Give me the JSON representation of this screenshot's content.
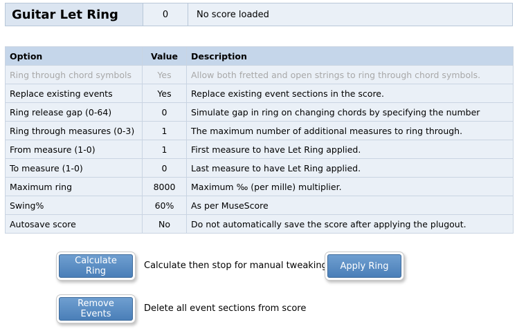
{
  "header": {
    "title": "Guitar Let Ring",
    "value": "0",
    "status": "No score loaded"
  },
  "table": {
    "columns": [
      "Option",
      "Value",
      "Description"
    ],
    "rows": [
      {
        "option": "Ring through chord symbols",
        "value": "Yes",
        "description": "Allow both fretted and open strings to ring through chord symbols."
      },
      {
        "option": "Replace existing events",
        "value": "Yes",
        "description": "Replace existing event sections in the score."
      },
      {
        "option": "Ring release gap (0-64)",
        "value": "0",
        "description": "Simulate gap in ring on changing chords by specifying the number"
      },
      {
        "option": "Ring through measures (0-3)",
        "value": "1",
        "description": "The maximum number of additional measures to ring through."
      },
      {
        "option": "From measure (1-0)",
        "value": "1",
        "description": "First measure to have Let Ring applied."
      },
      {
        "option": "To measure (1-0)",
        "value": "0",
        "description": "Last measure to have Let Ring applied."
      },
      {
        "option": "Maximum ring",
        "value": "8000",
        "description": "Maximum ‰ (per mille) multiplier."
      },
      {
        "option": "Swing%",
        "value": "60%",
        "description": "As per MuseScore"
      },
      {
        "option": "Autosave score",
        "value": "No",
        "description": "Do not automatically save the score after applying the plugout."
      }
    ]
  },
  "actions": {
    "calculate_label": "Calculate Ring",
    "calculate_desc": "Calculate then stop for manual tweaking",
    "apply_label": "Apply Ring",
    "remove_label": "Remove Events",
    "remove_desc": "Delete all event sections from score"
  }
}
